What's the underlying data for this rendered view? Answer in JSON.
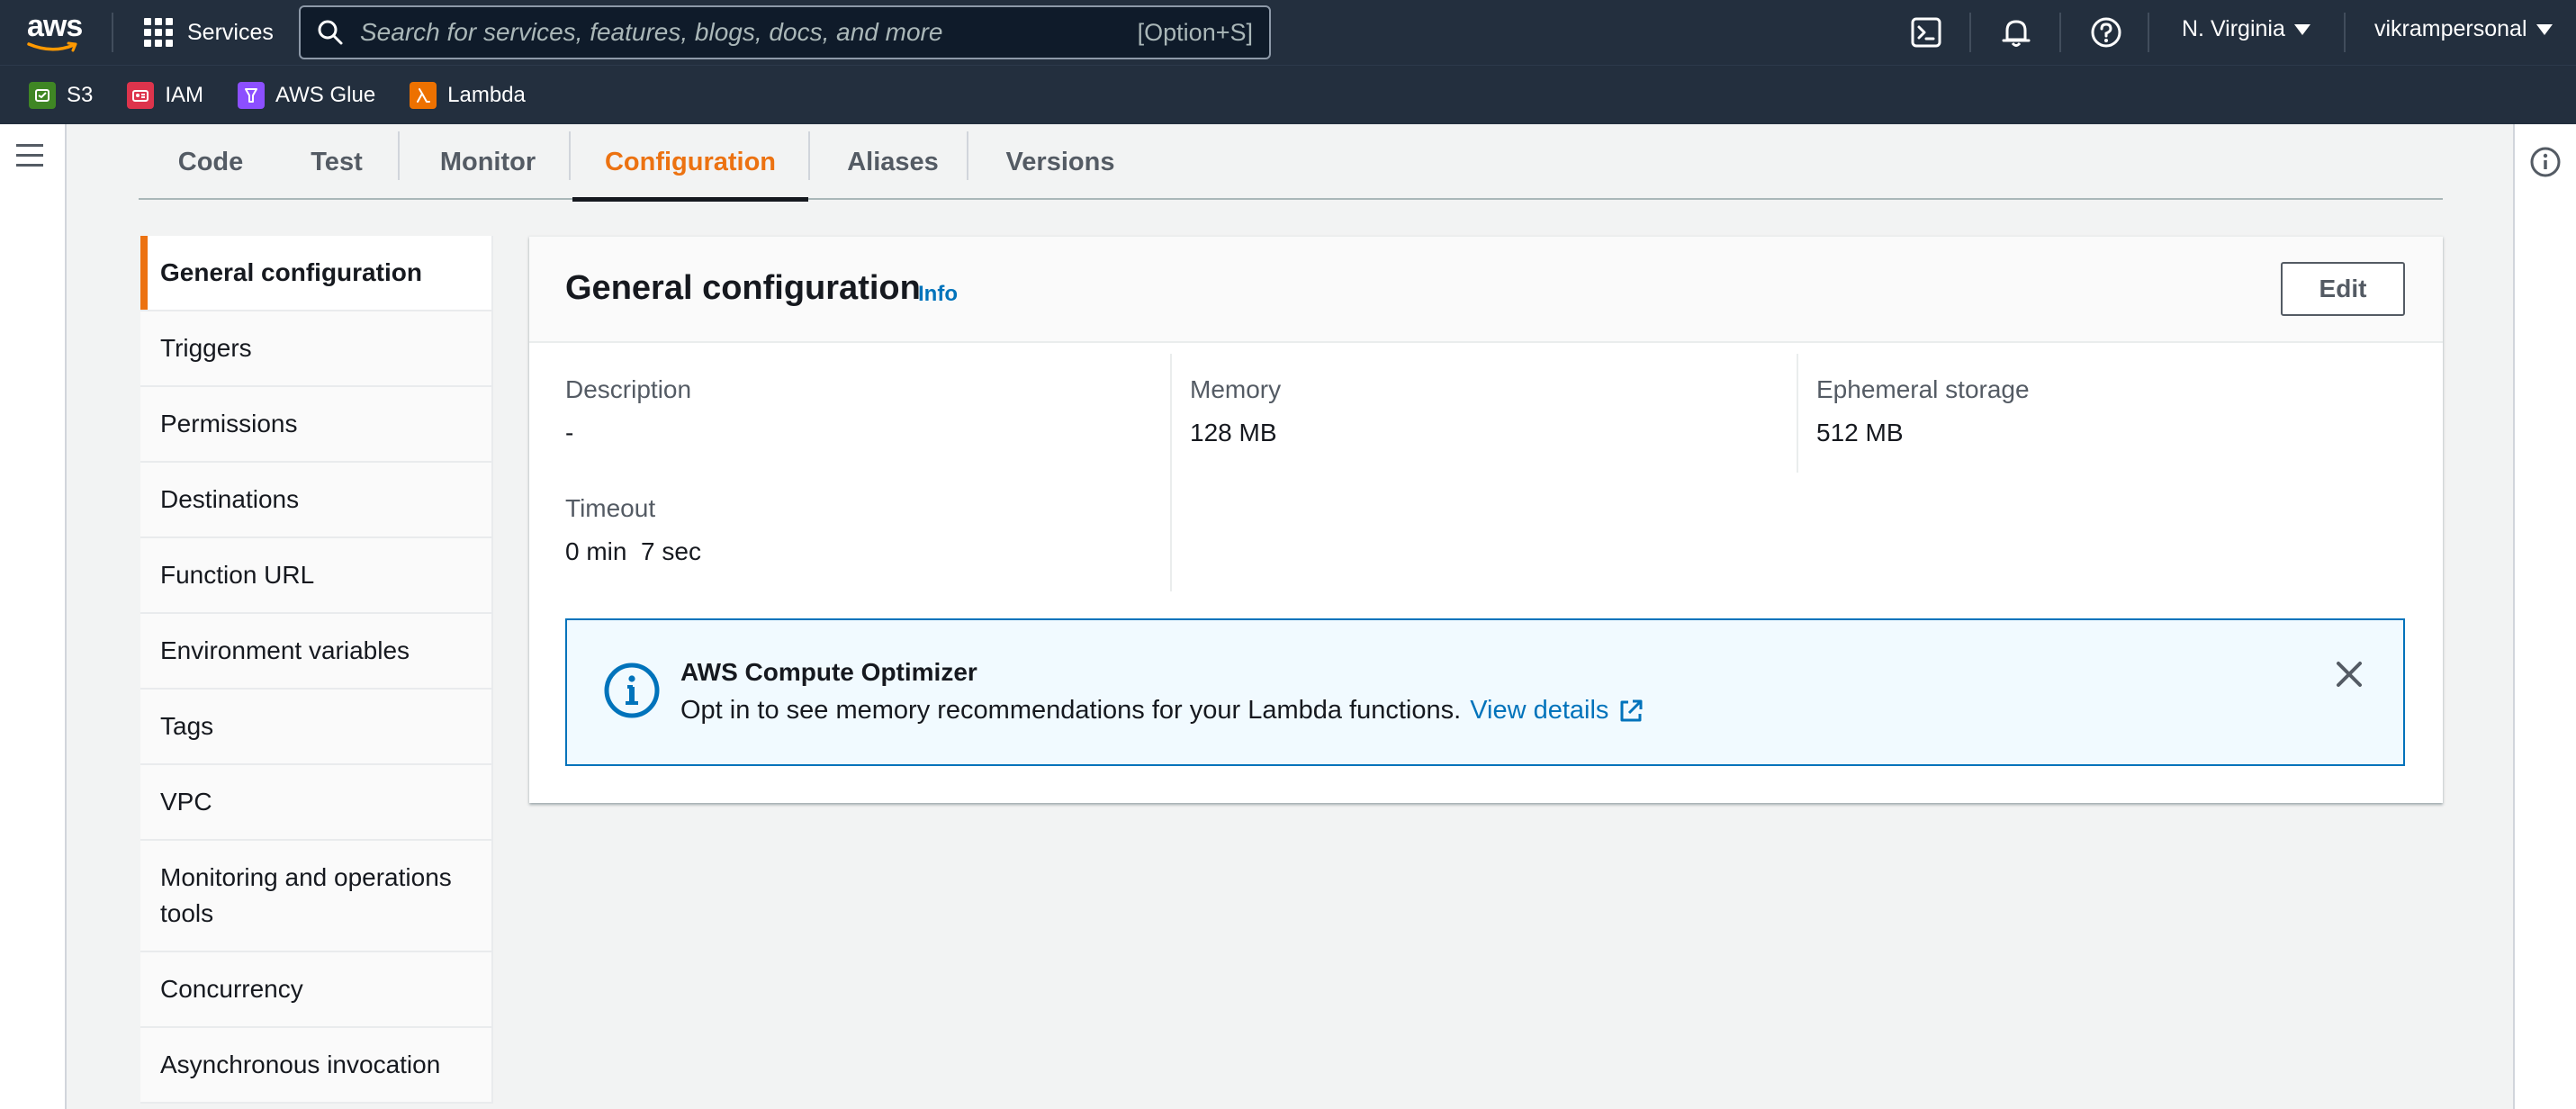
{
  "nav": {
    "logo": "aws",
    "services_label": "Services",
    "search_placeholder": "Search for services, features, blogs, docs, and more",
    "search_shortcut": "[Option+S]",
    "region": "N. Virginia",
    "account": "vikrampersonal",
    "icons": [
      "cloudshell-icon",
      "bell-icon",
      "help-icon"
    ]
  },
  "favorites": [
    {
      "label": "S3",
      "icon": "s3-icon",
      "color": "#3f8624"
    },
    {
      "label": "IAM",
      "icon": "iam-icon",
      "color": "#dd344c"
    },
    {
      "label": "AWS Glue",
      "icon": "glue-icon",
      "color": "#8c4fff"
    },
    {
      "label": "Lambda",
      "icon": "lambda-icon",
      "color": "#ed7100"
    }
  ],
  "tabs": [
    {
      "label": "Code"
    },
    {
      "label": "Test"
    },
    {
      "label": "Monitor"
    },
    {
      "label": "Configuration",
      "active": true
    },
    {
      "label": "Aliases"
    },
    {
      "label": "Versions"
    }
  ],
  "config_nav": [
    {
      "label": "General configuration",
      "active": true
    },
    {
      "label": "Triggers"
    },
    {
      "label": "Permissions"
    },
    {
      "label": "Destinations"
    },
    {
      "label": "Function URL"
    },
    {
      "label": "Environment variables"
    },
    {
      "label": "Tags"
    },
    {
      "label": "VPC"
    },
    {
      "label": "Monitoring and operations tools"
    },
    {
      "label": "Concurrency"
    },
    {
      "label": "Asynchronous invocation"
    }
  ],
  "panel": {
    "title": "General configuration",
    "info_link": "Info",
    "edit_label": "Edit",
    "description_label": "Description",
    "description_value": "-",
    "memory_label": "Memory",
    "memory_value": "128 MB",
    "ephemeral_label": "Ephemeral storage",
    "ephemeral_value": "512 MB",
    "timeout_label": "Timeout",
    "timeout_value": "0 min  7 sec"
  },
  "alert": {
    "title": "AWS Compute Optimizer",
    "body": "Opt in to see memory recommendations for your Lambda functions.",
    "link": "View details"
  },
  "colors": {
    "nav_bg": "#232f3e",
    "accent": "#ec7211",
    "link": "#0073bb"
  }
}
